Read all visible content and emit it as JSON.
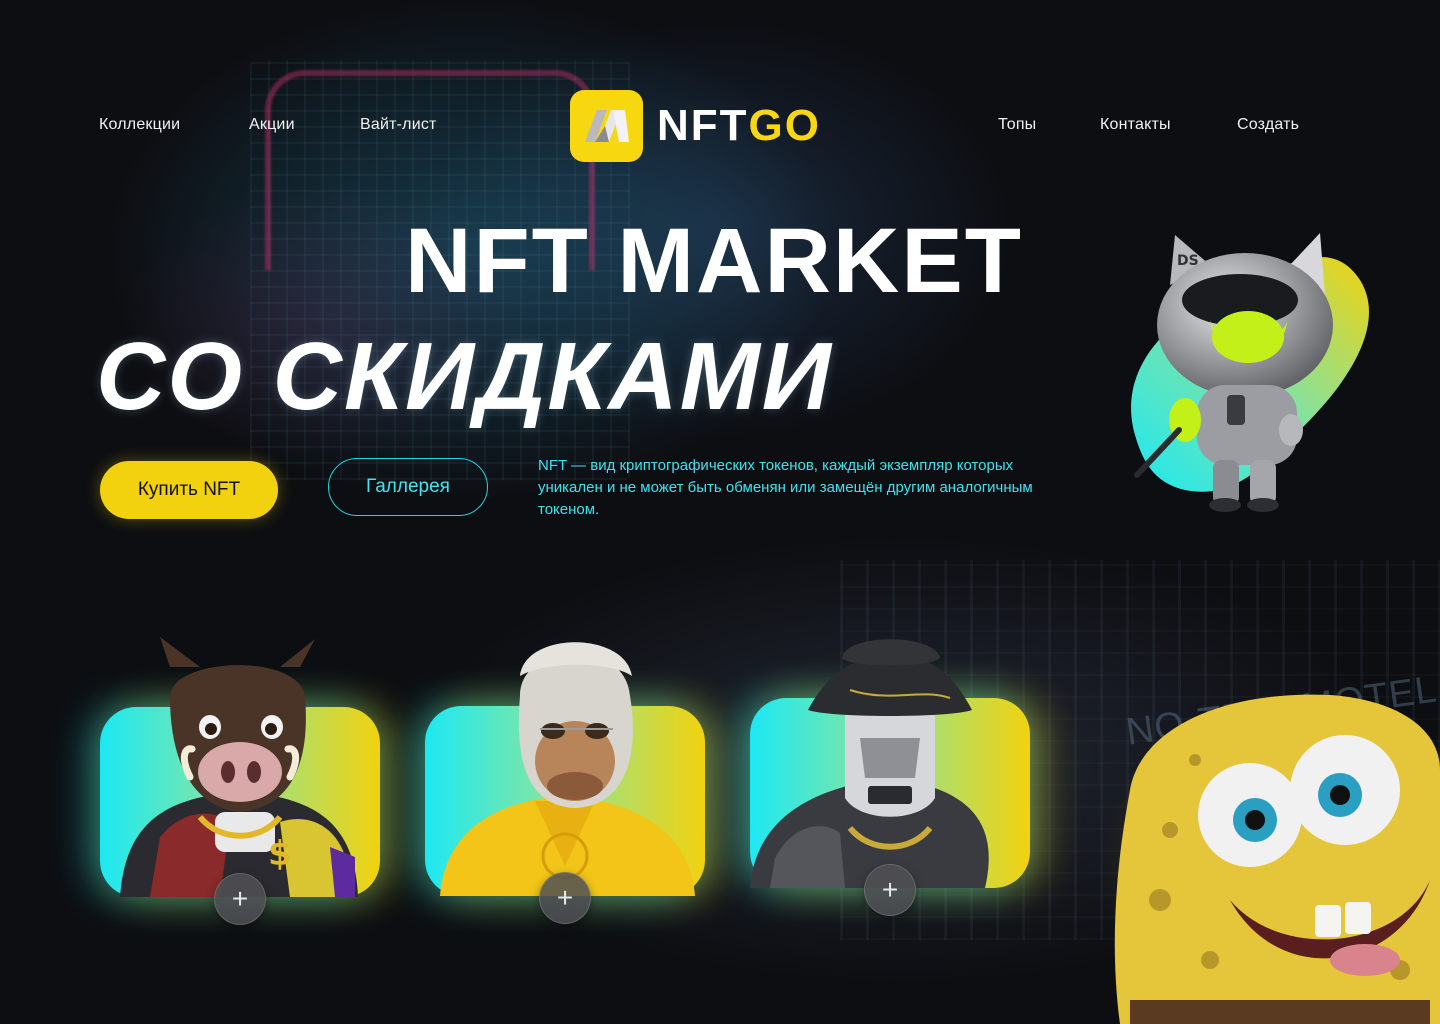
{
  "nav": {
    "left_links": [
      "Коллекции",
      "Акции",
      "Вайт-лист"
    ],
    "right_links": [
      "Топы",
      "Контакты",
      "Создать"
    ],
    "logo": {
      "prefix": "NFT",
      "accent": "GO",
      "accent_color": "#f7d70f"
    }
  },
  "hero": {
    "title_line1": "NFT MARKET",
    "title_line2": "СО СКИДКАМИ",
    "buy_button": "Купить NFT",
    "gallery_button": "Галлерея",
    "description": "NFT — вид криптографических токенов, каждый экземпляр которых уникален и не может быть обменян или замещён другим аналогичным токеном."
  },
  "background": {
    "sign_text": "NO-TELL MOTEL"
  },
  "cards": [
    {
      "name": "boar",
      "add_symbol": "+"
    },
    {
      "name": "ape",
      "add_symbol": "+"
    },
    {
      "name": "robot",
      "add_symbol": "+"
    }
  ],
  "colors": {
    "accent_yellow": "#f2d20f",
    "accent_cyan": "#1de8f3",
    "background": "#0d0e12"
  },
  "icons": {
    "logo": "nftgo-logo-icon",
    "add": "plus-icon"
  }
}
